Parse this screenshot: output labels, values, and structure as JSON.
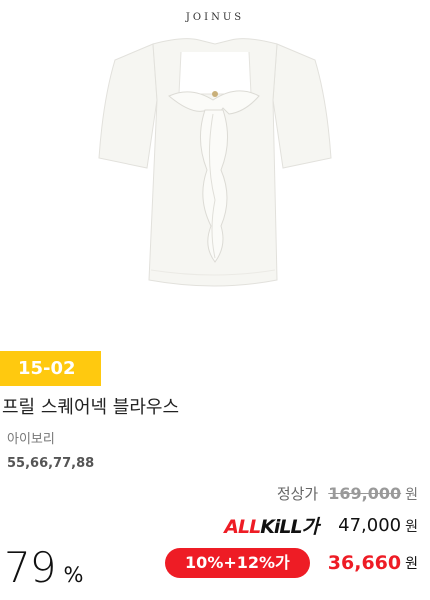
{
  "brand": "JOINUS",
  "promo_badge": "15-02",
  "product": {
    "name": "프릴 스퀘어넥 블라우스",
    "color": "아이보리",
    "sizes": "55,66,77,88"
  },
  "price": {
    "regular_label": "정상가",
    "regular_price": "169,000",
    "allkill_logo_prefix": "ALL",
    "allkill_logo_suffix": "KiLL가",
    "allkill_price": "47,000",
    "discount_label": "10%+12%가",
    "final_price": "36,660",
    "currency": "원",
    "discount_rate": "79",
    "percent_sign": "%"
  },
  "colors": {
    "badge": "#ffc90f",
    "accent_red": "#ee1c25"
  },
  "icons": {
    "product_image": "ivory-ruffle-blouse"
  }
}
